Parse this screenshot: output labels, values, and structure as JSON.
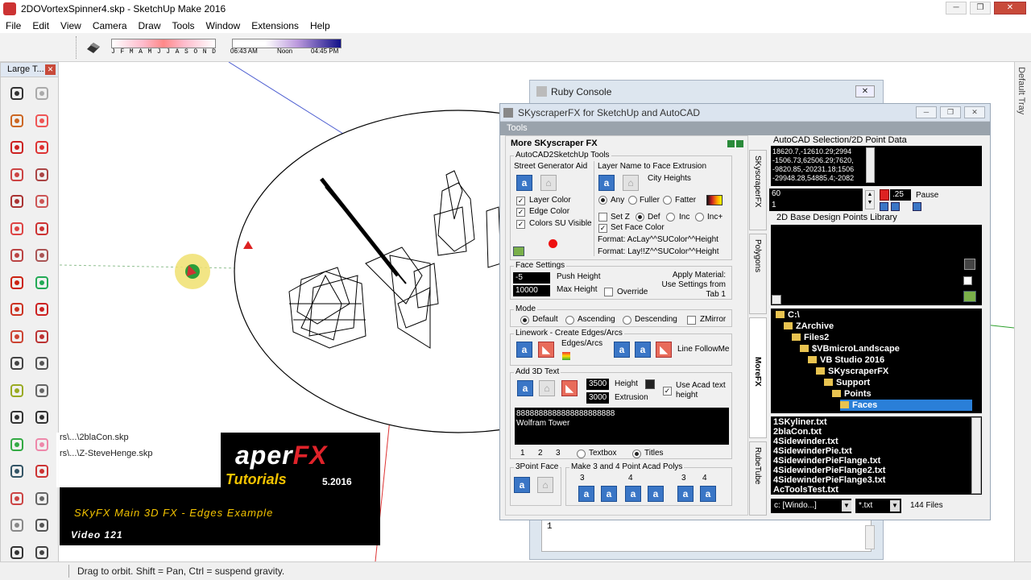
{
  "window": {
    "title": "2DOVortexSpinner4.skp - SketchUp Make 2016"
  },
  "menu": [
    "File",
    "Edit",
    "View",
    "Camera",
    "Draw",
    "Tools",
    "Window",
    "Extensions",
    "Help"
  ],
  "shadows": {
    "months": [
      "J",
      "F",
      "M",
      "A",
      "M",
      "J",
      "J",
      "A",
      "S",
      "O",
      "N",
      "D"
    ],
    "time_start": "06:43 AM",
    "time_mid": "Noon",
    "time_end": "04:45 PM"
  },
  "large_toolset": {
    "title": "Large T...",
    "tools": [
      "select",
      "make-component",
      "paint-bucket",
      "eraser",
      "line",
      "freehand",
      "rectangle",
      "rotated-rectangle",
      "circle",
      "polygon",
      "arc",
      "2-point-arc",
      "3-point-arc",
      "pie",
      "move",
      "push-pull",
      "rotate",
      "follow-me",
      "scale",
      "offset",
      "tape-measure",
      "dimension",
      "protractor",
      "text",
      "axes",
      "3d-text",
      "orbit",
      "pan",
      "zoom",
      "zoom-window",
      "zoom-extents",
      "previous",
      "position-camera",
      "look-around",
      "walk",
      "section-plane"
    ]
  },
  "tray_label": "Default Tray",
  "status_text": "Drag to orbit. Shift = Pan, Ctrl = suspend gravity.",
  "ruby_console": {
    "title": "Ruby Console",
    "line_number": "1"
  },
  "skyfx": {
    "title": "SKyscraperFX for SketchUp and AutoCAD",
    "menu": "Tools",
    "section_title": "More SKyscraper FX",
    "group_acad": "AutoCAD2SketchUp Tools",
    "street_gen": "Street Generator Aid",
    "layer_color": "Layer Color",
    "edge_color": "Edge Color",
    "colors_visible": "Colors SU Visible",
    "layer_name": "Layer Name to Face Extrusion",
    "city_heights": "City Heights",
    "any": "Any",
    "fuller": "Fuller",
    "fatter": "Fatter",
    "setz": "Set Z",
    "def": "Def",
    "inc": "Inc",
    "incplus": "Inc+",
    "set_face_color": "Set Face Color",
    "format1": "Format: AcLay^^SUColor^^Height",
    "format2": "Format: Lay!!Z^^SUColor^^Height",
    "face_settings": "Face Settings",
    "push_value": "-5",
    "push_height": "Push Height",
    "max_value": "10000",
    "max_height": "Max Height",
    "override": "Override",
    "apply_material": "Apply Material: Use Settings from Tab 1",
    "mode": "Mode",
    "mode_default": "Default",
    "mode_asc": "Ascending",
    "mode_desc": "Descending",
    "mode_zmirror": "ZMirror",
    "linework": "Linework - Create Edges/Arcs",
    "edges_arcs": "Edges/Arcs",
    "line_followme": "Line FollowMe",
    "add_3d_text": "Add 3D Text",
    "height_value": "3500",
    "height_label": "Height",
    "extrusion_value": "3000",
    "extrusion_label": "Extrusion",
    "use_acad": "Use Acad text height",
    "text_line1": "8888888888888888888888",
    "text_line2": "Wolfram Tower",
    "tab1": "1",
    "tab2": "2",
    "tab3": "3",
    "textbox": "Textbox",
    "titles": "Titles",
    "three_point_face": "3Point Face",
    "make_polys": "Make 3 and 4 Point Acad Polys",
    "poly_nums": [
      "3",
      "4",
      "3",
      "4"
    ],
    "acad_title": "AutoCAD Selection/2D Point Data",
    "acad_lines": [
      "18620.7,-12610.29;2994",
      "-1506.73,62506.29;7620,",
      "-9820.85,-20231.18;1506",
      "-29948.28,54885.4;-2082"
    ],
    "field_60": "60",
    "field_1": "1",
    "scale_value": ".25",
    "pause": "Pause",
    "library_title": "2D Base Design Points Library",
    "tree": [
      {
        "name": "C:\\",
        "indent": 0
      },
      {
        "name": "ZArchive",
        "indent": 1
      },
      {
        "name": "Files2",
        "indent": 2
      },
      {
        "name": "$VBmicroLandscape",
        "indent": 3
      },
      {
        "name": "VB Studio 2016",
        "indent": 4
      },
      {
        "name": "SKyscraperFX",
        "indent": 5
      },
      {
        "name": "Support",
        "indent": 6
      },
      {
        "name": "Points",
        "indent": 7
      },
      {
        "name": "Faces",
        "indent": 8
      }
    ],
    "files": [
      "1SKyliner.txt",
      "2blaCon.txt",
      "4Sidewinder.txt",
      "4SidewinderPie.txt",
      "4SidewinderPieFlange.txt",
      "4SidewinderPieFlange2.txt",
      "4SidewinderPieFlange3.txt",
      "AcToolsTest.txt"
    ],
    "drive": "c: [Windo...]",
    "filter": "*.txt",
    "file_count": "144 Files",
    "tabs": [
      "SKyscraperFX",
      "Polygons",
      "MoreFX",
      "RubeTube"
    ]
  },
  "recent_files": [
    "rs\\...\\2blaCon.skp",
    "rs\\...\\Z-SteveHenge.skp"
  ],
  "banner": {
    "brand_a": "aper",
    "brand_b": "FX",
    "tutorials": "Tutorials",
    "date": "5.2016",
    "subtitle": "SKyFX Main 3D FX - Edges Example",
    "video": "Video 121"
  }
}
